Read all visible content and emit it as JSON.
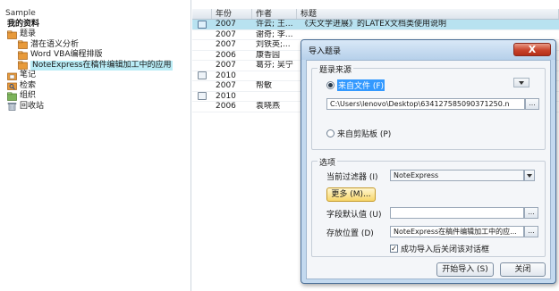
{
  "tree": {
    "root": "Sample",
    "library": "我的资料",
    "folders": [
      {
        "label": "题录",
        "icon": "folder-icon",
        "level": 1
      },
      {
        "label": "潜在语义分析",
        "icon": "subfolder-icon",
        "level": 2
      },
      {
        "label": "Word VBA编程排版",
        "icon": "subfolder-icon",
        "level": 2
      },
      {
        "label": "NoteExpress在稿件编辑加工中的应用",
        "icon": "subfolder-icon",
        "level": 2,
        "selected": true
      },
      {
        "label": "笔记",
        "icon": "notes-folder-icon",
        "level": 1
      },
      {
        "label": "检索",
        "icon": "search-folder-icon",
        "level": 1
      },
      {
        "label": "组织",
        "icon": "organize-folder-icon",
        "level": 1
      },
      {
        "label": "回收站",
        "icon": "recycle-bin-icon",
        "level": 1
      }
    ]
  },
  "list": {
    "columns": {
      "year": "年份",
      "author": "作者",
      "title": "标题"
    },
    "rows": [
      {
        "year": "2007",
        "author": "许云; 王...",
        "title": "《天文学进展》的LATEX文档类使用说明",
        "icon": "attachment-icon",
        "selected": true
      },
      {
        "year": "2007",
        "author": "谢奇; 李...",
        "title": "",
        "icon": "",
        "selected": false
      },
      {
        "year": "2007",
        "author": "刘铁英;...",
        "title": "",
        "icon": "",
        "selected": false
      },
      {
        "year": "2006",
        "author": "康香园",
        "title": "",
        "icon": "",
        "selected": false
      },
      {
        "year": "2007",
        "author": "葛芬; 吴宁",
        "title": "",
        "icon": "",
        "selected": false
      },
      {
        "year": "2010",
        "author": "",
        "title": "",
        "icon": "attachment-icon",
        "selected": false
      },
      {
        "year": "2007",
        "author": "帮敏",
        "title": "",
        "icon": "",
        "selected": false
      },
      {
        "year": "2010",
        "author": "",
        "title": "",
        "icon": "attachment-icon",
        "selected": false
      },
      {
        "year": "2006",
        "author": "袁晓燕",
        "title": "",
        "icon": "",
        "selected": false
      }
    ]
  },
  "dialog": {
    "title": "导入题录",
    "close_label": "X",
    "source_group": "题录来源",
    "from_file_label": "来自文件 (F)",
    "file_path": "C:\\Users\\lenovo\\Desktop\\634127585090371250.n",
    "file_browse_label": "...",
    "from_clipboard_label": "来自剪贴板 (P)",
    "options_group": "选项",
    "filter_label": "当前过滤器 (I)",
    "filter_value": "NoteExpress",
    "more_button": "更多 (M)...",
    "default_field_label": "字段默认值 (U)",
    "default_field_value": "",
    "default_field_browse": "...",
    "save_location_label": "存放位置 (D)",
    "save_location_value": "NoteExpress在稿件编辑加工中的应...",
    "save_location_browse": "...",
    "close_after_import_label": "成功导入后关闭该对话框",
    "close_after_import_checked": true,
    "start_import_button": "开始导入 (S)",
    "close_button": "关闭"
  },
  "colors": {
    "selection": "#b8e2f0",
    "dialog_frame": "#c3d9ef",
    "close_red": "#c8432b",
    "folder_orange": "#e89a3a"
  }
}
